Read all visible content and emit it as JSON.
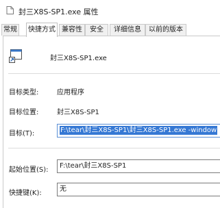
{
  "window": {
    "title": "封三X8S-SP1.exe 属性"
  },
  "tabs": [
    {
      "label": "常规"
    },
    {
      "label": "快捷方式"
    },
    {
      "label": "兼容性"
    },
    {
      "label": "安全"
    },
    {
      "label": "详细信息"
    },
    {
      "label": "以前的版本"
    }
  ],
  "active_tab": "快捷方式",
  "file": {
    "name": "封三X8S-SP1.exe"
  },
  "fields": {
    "target_type_label": "目标类型:",
    "target_type_value": "应用程序",
    "target_location_label": "目标位置:",
    "target_location_value": "封三X8S-SP1",
    "target_label": "目标(T):",
    "target_value": "F:\\tear\\封三X8S-SP1\\封三X8S-SP1.exe -window",
    "start_in_label": "起始位置(S):",
    "start_in_value": "F:\\tear\\封三X8S-SP1",
    "shortcut_key_label": "快捷键(K):",
    "shortcut_key_value": "无"
  },
  "icons": {
    "title": "shortcut-file-icon",
    "app": "application-shortcut-icon"
  },
  "colors": {
    "selection": "#3578d4",
    "border": "#c9c9c9",
    "focus_border": "#5a8fd6"
  }
}
